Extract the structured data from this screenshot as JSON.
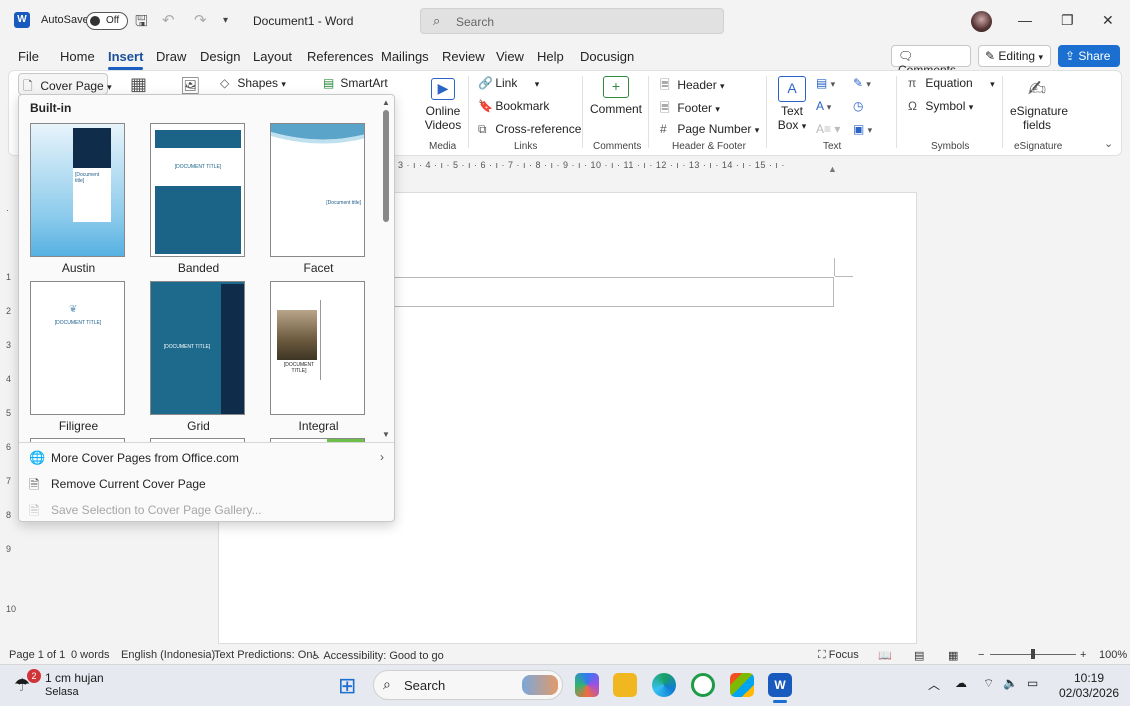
{
  "titlebar": {
    "autosave_label": "AutoSave",
    "autosave_state": "Off",
    "document_title": "Document1  -  Word",
    "search_placeholder": "Search"
  },
  "menu": {
    "tabs": [
      "File",
      "Home",
      "Insert",
      "Draw",
      "Design",
      "Layout",
      "References",
      "Mailings",
      "Review",
      "View",
      "Help",
      "Docusign"
    ],
    "active": "Insert",
    "comments": "Comments",
    "editing": "Editing",
    "share": "Share"
  },
  "ribbon": {
    "cover_page": "Cover Page",
    "shapes": "Shapes",
    "smartart": "SmartArt",
    "online_videos": "Online Videos",
    "online_label_1": "Online",
    "online_label_2": "Videos",
    "link": "Link",
    "bookmark": "Bookmark",
    "cross_reference": "Cross-reference",
    "comment": "Comment",
    "header": "Header",
    "footer": "Footer",
    "page_number": "Page Number",
    "text_box_1": "Text",
    "text_box_2": "Box",
    "equation": "Equation",
    "symbol": "Symbol",
    "esig_1": "eSignature",
    "esig_2": "fields",
    "groups": {
      "media": "Media",
      "links": "Links",
      "comments": "Comments",
      "header_footer": "Header & Footer",
      "text": "Text",
      "symbols": "Symbols",
      "esignature": "eSignature"
    }
  },
  "ruler": {
    "text": "3 · ı · 4 · ı · 5 · ı · 6 · ı · 7 · ı · 8 · ı · 9 · ı · 10 · ı · 11 · ı · 12 · ı · 13 · ı · 14 · ı · 15 · ı ·",
    "vertical_numbers": [
      "1",
      "2",
      "3",
      "4",
      "5",
      "6",
      "7",
      "8",
      "9",
      "10"
    ]
  },
  "cover_dropdown": {
    "heading": "Built-in",
    "thumbs": [
      {
        "name": "Austin",
        "text": "[Document title]"
      },
      {
        "name": "Banded",
        "text": "[DOCUMENT TITLE]"
      },
      {
        "name": "Facet",
        "text": "[Document title]"
      },
      {
        "name": "Filigree",
        "text": "[DOCUMENT TITLE]"
      },
      {
        "name": "Grid",
        "text": "[DOCUMENT TITLE]"
      },
      {
        "name": "Integral",
        "text": "[DOCUMENT TITLE]"
      }
    ],
    "more": "More Cover Pages from Office.com",
    "remove": "Remove Current Cover Page",
    "save": "Save Selection to Cover Page Gallery..."
  },
  "statusbar": {
    "page": "Page 1 of 1",
    "words": "0 words",
    "language": "English (Indonesia)",
    "predictions": "Text Predictions: On",
    "accessibility": "Accessibility: Good to go",
    "focus": "Focus",
    "zoom": "100%"
  },
  "taskbar": {
    "weather_badge": "2",
    "weather_1": "1 cm hujan",
    "weather_2": "Selasa",
    "search": "Search",
    "time": "10:19",
    "date": "02/03/2026"
  },
  "colors": {
    "accent": "#1a5fc1",
    "banded": "#1b6488",
    "grid_light": "#1d6a8c",
    "grid_dark": "#0f2d4a"
  }
}
